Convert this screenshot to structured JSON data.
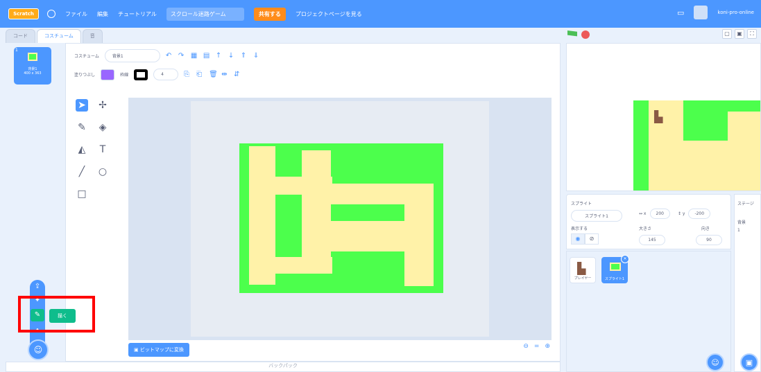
{
  "menu": {
    "logo": "Scratch",
    "file": "ファイル",
    "edit": "編集",
    "tutorial": "チュートリアル",
    "project_title": "スクロール迷路ゲーム",
    "share": "共有する",
    "project_page": "プロジェクトページを見る",
    "username": "koni-pro-online"
  },
  "tabs": {
    "code": "コード",
    "costume": "コスチューム",
    "sound": "音"
  },
  "costume_list": {
    "item_index": "1",
    "item_name": "背景1",
    "item_size": "400 x 363"
  },
  "editor": {
    "costume_label": "コスチューム",
    "costume_name": "背景1",
    "fill_label": "塗りつぶし",
    "outline_label": "枠線",
    "outline_width": "4",
    "convert_button": "ビットマップに変換",
    "fill_color": "#9966ff",
    "outline_color": "#000000"
  },
  "add_menu": {
    "tooltip": "描く"
  },
  "backpack": "バックパック",
  "sprite_info": {
    "sprite_label": "スプライト",
    "sprite_name": "スプライト1",
    "x_value": "200",
    "y_value": "-200",
    "show_label": "表示する",
    "size_label": "大きさ",
    "size_value": "145",
    "direction_label": "向き",
    "direction_value": "90"
  },
  "sprites": [
    {
      "name": "プレイヤー"
    },
    {
      "name": "スプライト1"
    }
  ],
  "stage_side": {
    "title": "ステージ",
    "backdrop_label": "背景",
    "backdrop_count": "1"
  },
  "colors": {
    "accent": "#4c97ff",
    "maze_wall": "#4cff4c",
    "maze_path": "#fff2a8",
    "highlight": "#ff0000",
    "paint_green": "#0fbd8c"
  }
}
